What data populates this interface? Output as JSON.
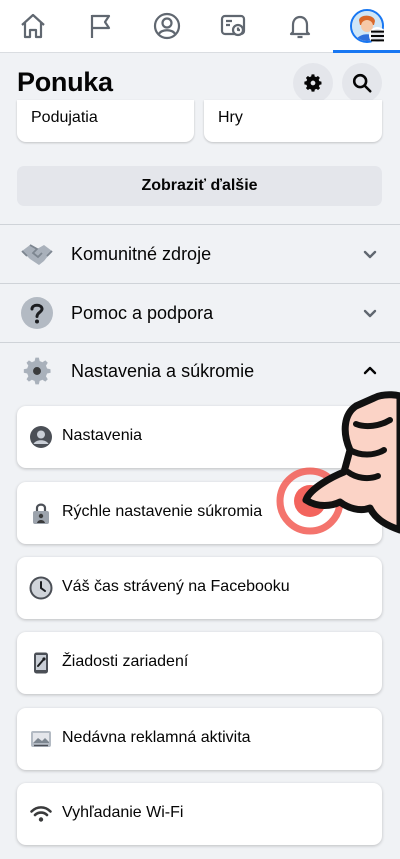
{
  "nav": {
    "tabs": [
      {
        "icon": "home-icon"
      },
      {
        "icon": "flag-icon"
      },
      {
        "icon": "profile-icon"
      },
      {
        "icon": "feeds-icon"
      },
      {
        "icon": "bell-icon"
      },
      {
        "icon": "avatar-menu-icon",
        "active": true
      }
    ]
  },
  "header": {
    "title": "Ponuka",
    "settings_icon": "gear-icon",
    "search_icon": "search-icon"
  },
  "shortcuts": {
    "left": "Podujatia",
    "right": "Hry"
  },
  "show_more": "Zobraziť ďalšie",
  "sections": [
    {
      "label": "Komunitné zdroje",
      "icon": "handshake-icon",
      "expanded": false
    },
    {
      "label": "Pomoc a podpora",
      "icon": "question-icon",
      "expanded": false
    },
    {
      "label": "Nastavenia a súkromie",
      "icon": "gear-icon",
      "expanded": true
    }
  ],
  "settings_items": [
    {
      "label": "Nastavenia",
      "icon": "account-icon"
    },
    {
      "label": "Rýchle nastavenie súkromia",
      "icon": "lock-icon"
    },
    {
      "label": "Váš čas strávený na Facebooku",
      "icon": "clock-icon"
    },
    {
      "label": "Žiadosti zariadení",
      "icon": "phone-icon"
    },
    {
      "label": "Nedávna reklamná aktivita",
      "icon": "ad-activity-icon"
    },
    {
      "label": "Vyhľadanie Wi-Fi",
      "icon": "wifi-icon"
    }
  ],
  "colors": {
    "accent": "#1877f2",
    "background": "#f0f2f5",
    "card": "#ffffff",
    "highlight": "#f25c54"
  }
}
